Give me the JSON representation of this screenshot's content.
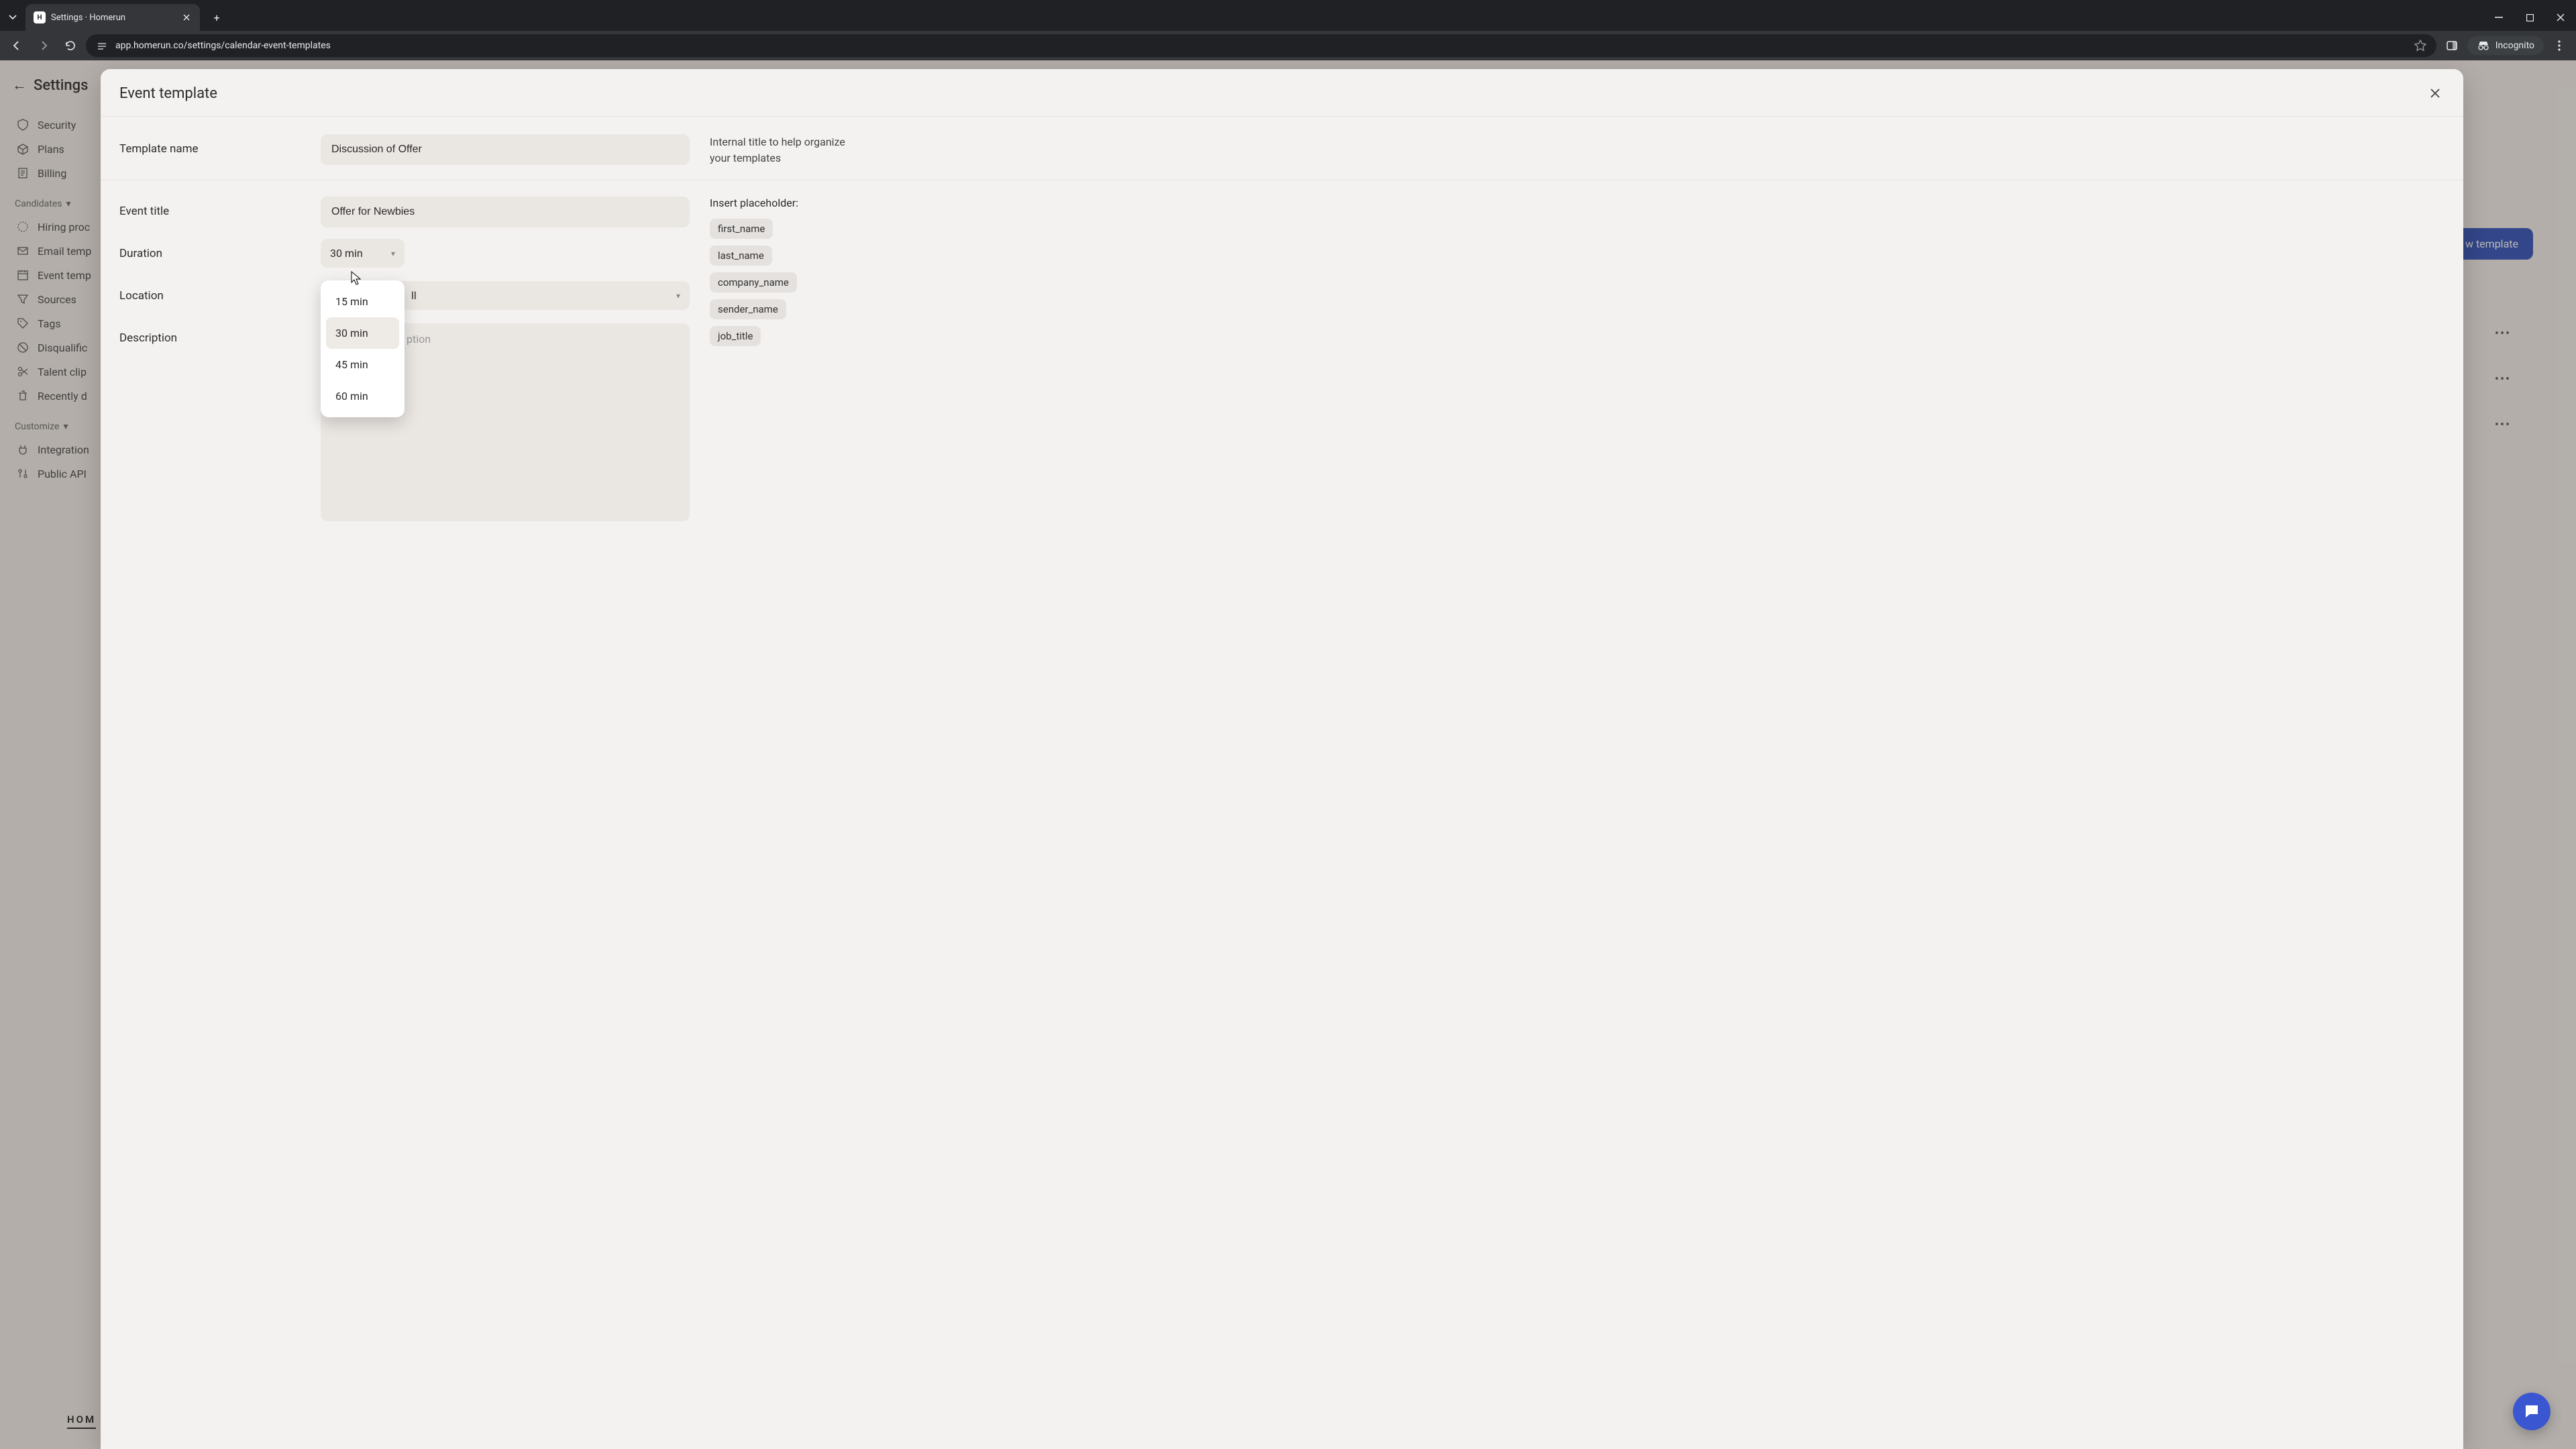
{
  "browser": {
    "tab_title": "Settings · Homerun",
    "url": "app.homerun.co/settings/calendar-event-templates",
    "incognito_label": "Incognito"
  },
  "sidebar": {
    "back_label": "Settings",
    "items_top": [
      {
        "label": "Security"
      },
      {
        "label": "Plans"
      },
      {
        "label": "Billing"
      }
    ],
    "section_candidates": "Candidates",
    "items_candidates": [
      {
        "label": "Hiring proc"
      },
      {
        "label": "Email temp"
      },
      {
        "label": "Event temp"
      },
      {
        "label": "Sources"
      },
      {
        "label": "Tags"
      },
      {
        "label": "Disqualific"
      },
      {
        "label": "Talent clip"
      },
      {
        "label": "Recently d"
      }
    ],
    "section_customize": "Customize",
    "items_customize": [
      {
        "label": "Integration"
      },
      {
        "label": "Public API"
      }
    ],
    "logo": "HOM"
  },
  "bg": {
    "new_template_label": "w template",
    "dots": "•••"
  },
  "modal": {
    "title": "Event template",
    "template_name_label": "Template name",
    "template_name_value": "Discussion of Offer",
    "template_name_hint": "Internal title to help organize your templates",
    "event_title_label": "Event title",
    "event_title_value": "Offer for Newbies",
    "duration_label": "Duration",
    "duration_value": "30 min",
    "duration_options": [
      "15 min",
      "30 min",
      "45 min",
      "60 min"
    ],
    "location_label": "Location",
    "location_value_partial": "ll",
    "description_label": "Description",
    "description_placeholder": "ption",
    "placeholder_label": "Insert placeholder:",
    "placeholders": [
      "first_name",
      "last_name",
      "company_name",
      "sender_name",
      "job_title"
    ]
  }
}
